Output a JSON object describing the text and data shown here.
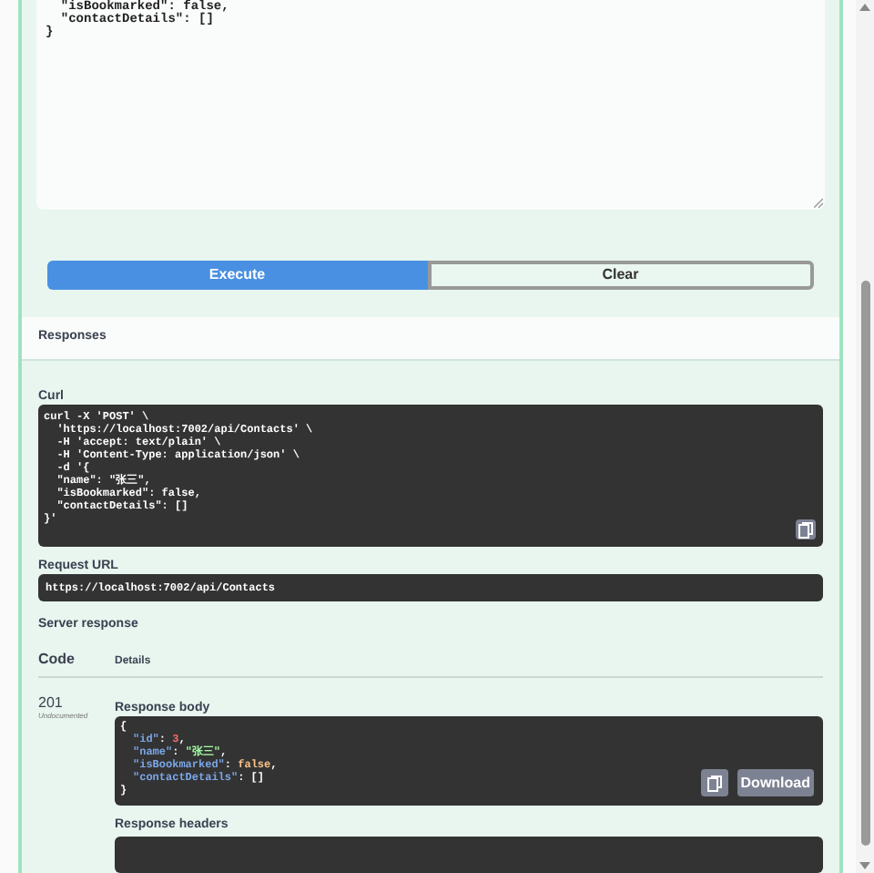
{
  "request_body": {
    "lines": [
      "\"isBookmarked\": false,",
      "\"contactDetails\": []",
      "}"
    ]
  },
  "buttons": [
    {
      "label": "Execute",
      "kind": "primary"
    },
    {
      "label": "Clear",
      "kind": "secondary"
    }
  ],
  "responses": {
    "title": "Responses",
    "curl": {
      "label": "Curl",
      "lines": [
        "curl -X 'POST' \\",
        "  'https://localhost:7002/api/Contacts' \\",
        "  -H 'accept: text/plain' \\",
        "  -H 'Content-Type: application/json' \\",
        "  -d '{",
        "  \"name\": \"张三\",",
        "  \"isBookmarked\": false,",
        "  \"contactDetails\": []",
        "}'"
      ]
    },
    "request_url": {
      "label": "Request URL",
      "value": "https://localhost:7002/api/Contacts"
    },
    "server_response": {
      "label": "Server response",
      "columns": [
        "Code",
        "Details"
      ],
      "code": "201",
      "code_note": "Undocumented",
      "body_label": "Response body",
      "body_lines": [
        {
          "indent": false,
          "tokens": [
            {
              "kind": "punct",
              "text": "{"
            }
          ]
        },
        {
          "indent": true,
          "tokens": [
            {
              "kind": "key",
              "text": "\"id\""
            },
            {
              "kind": "punct",
              "text": ": "
            },
            {
              "kind": "number",
              "text": "3"
            },
            {
              "kind": "punct",
              "text": ","
            }
          ]
        },
        {
          "indent": true,
          "tokens": [
            {
              "kind": "key",
              "text": "\"name\""
            },
            {
              "kind": "punct",
              "text": ": "
            },
            {
              "kind": "string",
              "text": "\"张三\""
            },
            {
              "kind": "punct",
              "text": ","
            }
          ]
        },
        {
          "indent": true,
          "tokens": [
            {
              "kind": "key",
              "text": "\"isBookmarked\""
            },
            {
              "kind": "punct",
              "text": ": "
            },
            {
              "kind": "literal",
              "text": "false"
            },
            {
              "kind": "punct",
              "text": ","
            }
          ]
        },
        {
          "indent": true,
          "tokens": [
            {
              "kind": "key",
              "text": "\"contactDetails\""
            },
            {
              "kind": "punct",
              "text": ": []"
            }
          ]
        },
        {
          "indent": false,
          "tokens": [
            {
              "kind": "punct",
              "text": "}"
            }
          ]
        }
      ],
      "download": "Download",
      "headers_label": "Response headers"
    }
  }
}
